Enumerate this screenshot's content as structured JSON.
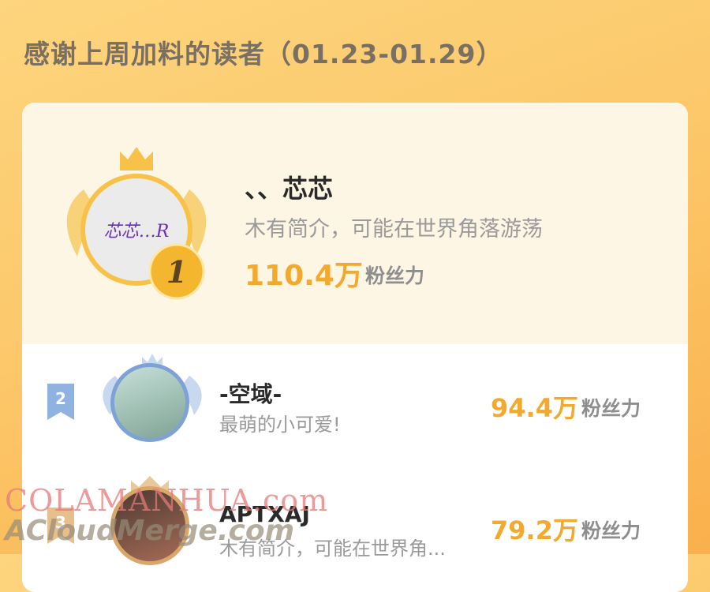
{
  "header": {
    "title": "感谢上周加料的读者（01.23-01.29）"
  },
  "first": {
    "rank": "1",
    "avatar_text": "芯芯…R",
    "name": "、、芯芯",
    "bio": "木有简介，可能在世界角落游荡",
    "fans_value": "110.4万",
    "fans_label": "粉丝力"
  },
  "rows": [
    {
      "rank": "2",
      "name": "-空域-",
      "bio": "最萌的小可爱!",
      "fans_value": "94.4万",
      "fans_label": "粉丝力"
    },
    {
      "rank": "3",
      "name": "APTXAJ",
      "bio": "木有简介，可能在世界角...",
      "fans_value": "79.2万",
      "fans_label": "粉丝力"
    }
  ],
  "watermarks": [
    "COLAMANHUA.com",
    "ACloudMerge.com"
  ],
  "colors": {
    "accent": "#f2a92d",
    "gold_ring": "#f8c24a",
    "silver": "#7fa2d6",
    "bronze": "#d9a76a"
  }
}
